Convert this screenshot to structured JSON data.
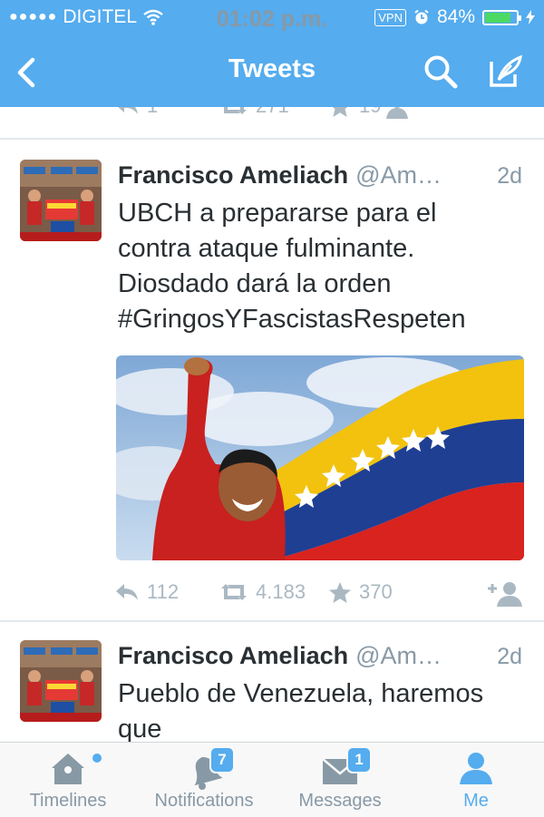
{
  "status_bar": {
    "signal": "●●●●●",
    "carrier": "DIGITEL",
    "time": "01:02 p.m.",
    "vpn": "VPN",
    "battery": "84%",
    "battery_level": 0.84
  },
  "nav": {
    "title": "Tweets"
  },
  "previous_tweet": {
    "replies": "1",
    "retweets": "271",
    "favorites": "19"
  },
  "tweets": [
    {
      "name": "Francisco Ameliach",
      "handle": "@Am…",
      "time": "2d",
      "lines": [
        "UBCH a prepararse para el",
        "contra ataque fulminante.",
        "Diosdado dará la orden",
        "#GringosYFascistasRespeten"
      ],
      "replies": "112",
      "retweets": "4.183",
      "favorites": "370"
    },
    {
      "name": "Francisco Ameliach",
      "handle": "@Am…",
      "time": "2d",
      "lines": [
        "Pueblo de Venezuela, haremos",
        "que"
      ]
    }
  ],
  "tabbar": {
    "timelines": "Timelines",
    "notifications": "Notifications",
    "notifications_badge": "7",
    "messages": "Messages",
    "messages_badge": "1",
    "me": "Me"
  },
  "colors": {
    "brand": "#55acee",
    "muted": "#8899a6",
    "icon_muted": "#aab8c2",
    "text": "#292f33"
  }
}
